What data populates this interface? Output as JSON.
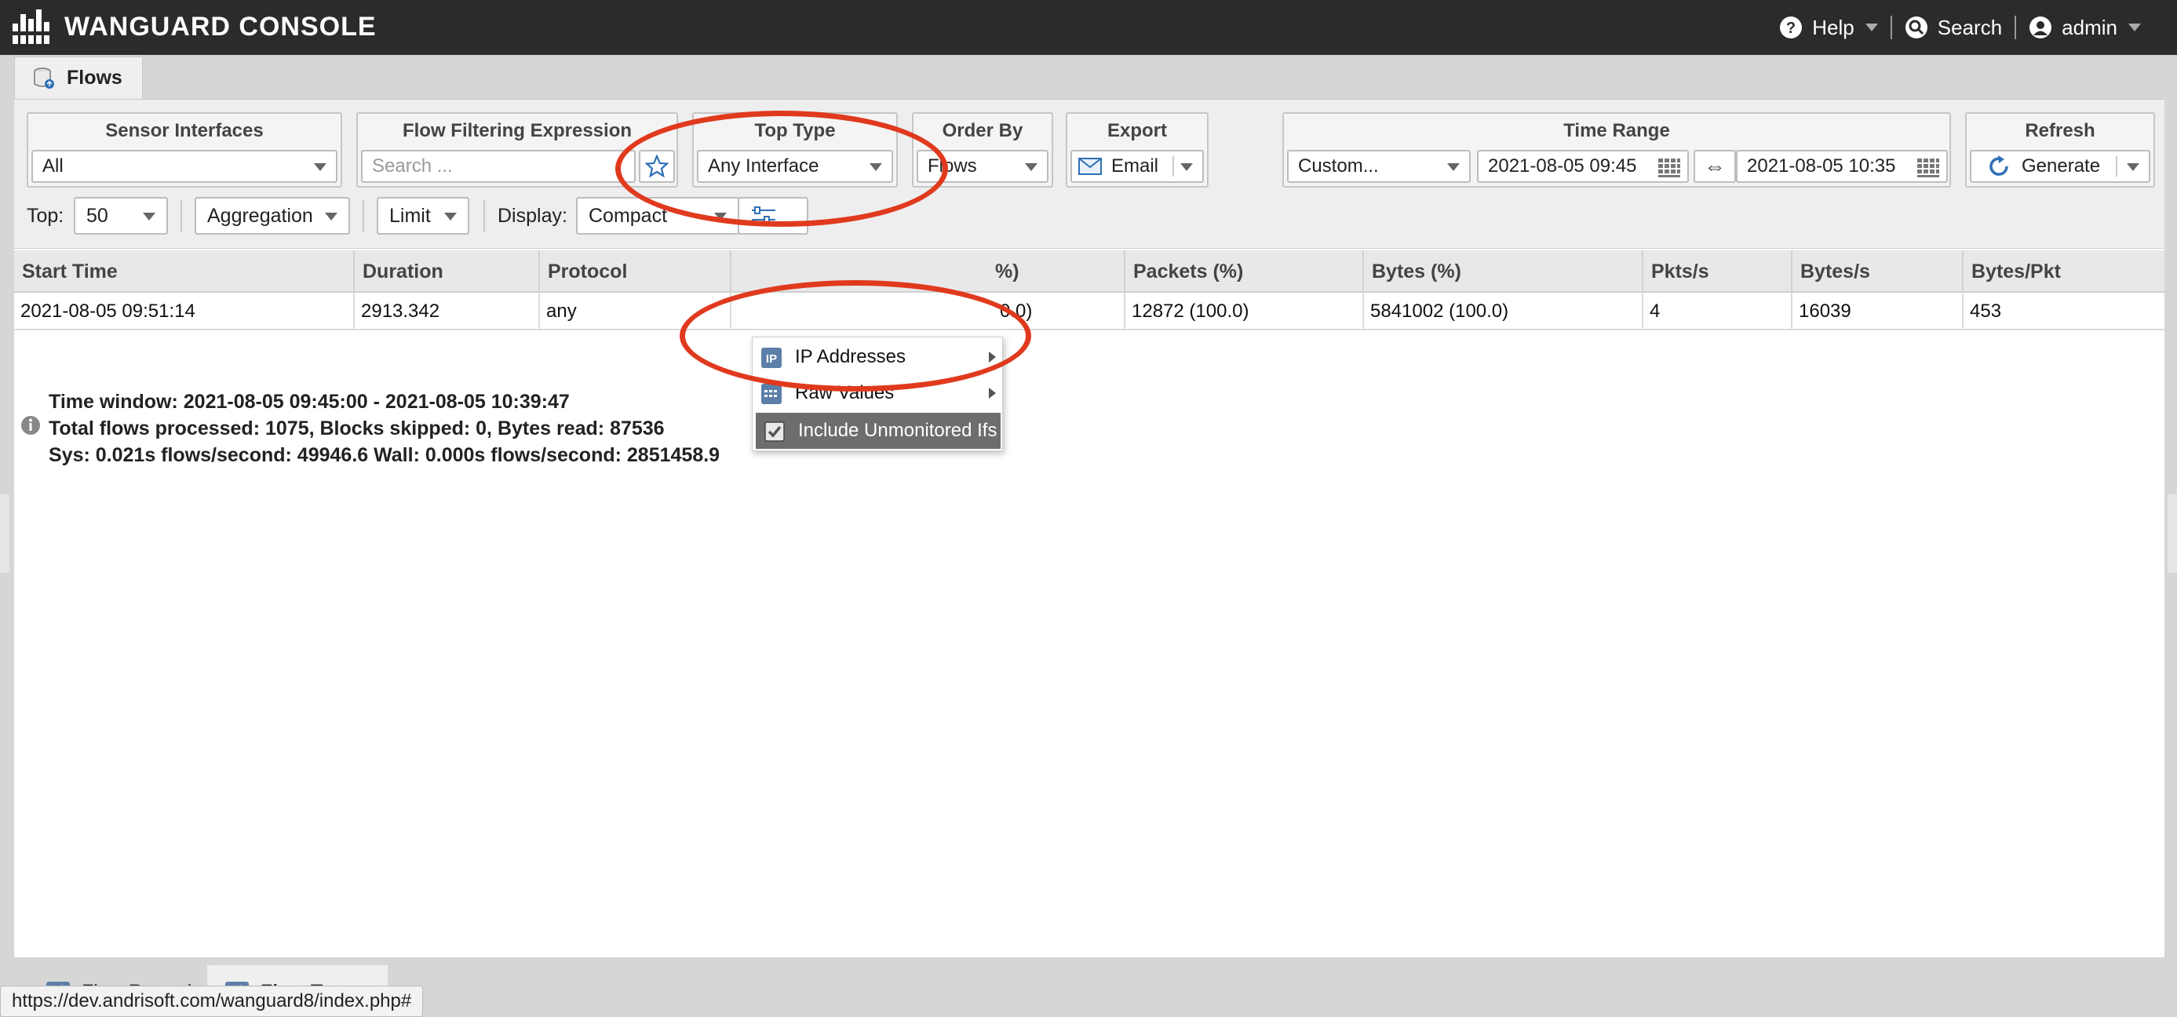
{
  "app": {
    "title": "WANGUARD CONSOLE"
  },
  "topnav": {
    "help": "Help",
    "search": "Search",
    "user": "admin"
  },
  "tab": {
    "label": "Flows"
  },
  "filters": {
    "sensor_interfaces": {
      "label": "Sensor Interfaces",
      "value": "All"
    },
    "flow_filter": {
      "label": "Flow Filtering Expression",
      "placeholder": "Search ..."
    },
    "top_type": {
      "label": "Top Type",
      "value": "Any Interface"
    },
    "order_by": {
      "label": "Order By",
      "value": "Flows"
    },
    "export": {
      "label": "Export",
      "value": "Email"
    },
    "time_range": {
      "label": "Time Range",
      "preset": "Custom...",
      "from": "2021-08-05 09:45",
      "to": "2021-08-05 10:35",
      "swap_symbol": "⇔"
    },
    "refresh": {
      "label": "Refresh",
      "value": "Generate"
    }
  },
  "options": {
    "top_label": "Top:",
    "top_value": "50",
    "aggregation": "Aggregation",
    "limit": "Limit",
    "display_label": "Display:",
    "display_value": "Compact"
  },
  "menu": {
    "items": [
      {
        "label": "IP Addresses",
        "icon": "ip-icon",
        "has_submenu": true
      },
      {
        "label": "Raw Values",
        "icon": "raw-values-icon",
        "has_submenu": true
      },
      {
        "label": "Include Unmonitored Ifs",
        "icon": "checkbox-checked-icon",
        "checked": true
      }
    ]
  },
  "table": {
    "columns": [
      "Start Time",
      "Duration",
      "Protocol",
      "Flows (%)",
      "Packets (%)",
      "Bytes (%)",
      "Pkts/s",
      "Bytes/s",
      "Bytes/Pkt"
    ],
    "visible_flows_header": "%)",
    "rows": [
      {
        "start_time": "2021-08-05 09:51:14",
        "duration": "2913.342",
        "protocol": "any",
        "flows_visible": "0.0)",
        "packets": "12872 (100.0)",
        "bytes": "5841002 (100.0)",
        "pkts_s": "4",
        "bytes_s": "16039",
        "bytes_pkt": "453"
      }
    ]
  },
  "stats": {
    "line1": "Time window: 2021-08-05 09:45:00 - 2021-08-05 10:39:47",
    "line2": "Total flows processed: 1075, Blocks skipped: 0, Bytes read: 87536",
    "line3": "Sys: 0.021s flows/second: 49946.6 Wall: 0.000s flows/second: 2851458.9"
  },
  "bottom_tabs": [
    {
      "label": "Flow Records"
    },
    {
      "label": "Flow Tops"
    }
  ],
  "status_url": "https://dev.andrisoft.com/wanguard8/index.php#",
  "colors": {
    "topbar": "#2b2b2b",
    "annotation": "#e03a1e",
    "accent": "#2e6fb5",
    "menu_active": "#6d6d6d"
  }
}
